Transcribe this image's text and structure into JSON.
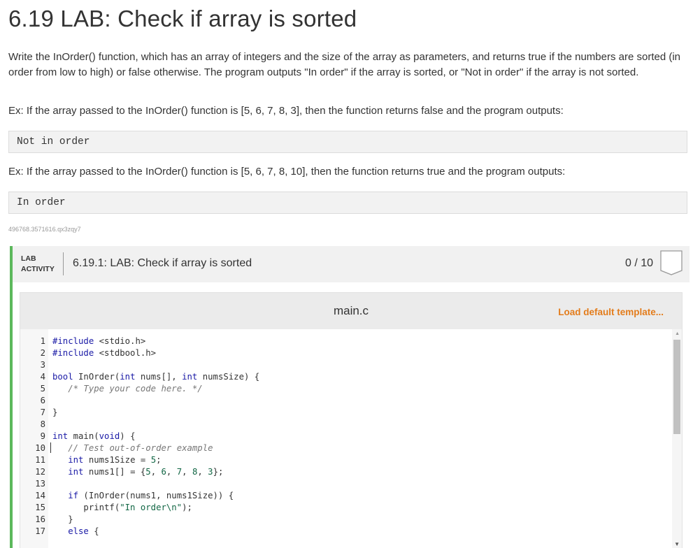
{
  "page": {
    "title": "6.19 LAB: Check if array is sorted",
    "description": "Write the InOrder() function, which has an array of integers and the size of the array as parameters, and returns true if the numbers are sorted (in order from low to high) or false otherwise. The program outputs \"In order\" if the array is sorted, or \"Not in order\" if the array is not sorted.",
    "example1": "Ex: If the array passed to the InOrder() function is [5, 6, 7, 8, 3], then the function returns false and the program outputs:",
    "output1": "Not in order",
    "example2": "Ex: If the array passed to the InOrder() function is [5, 6, 7, 8, 10], then the function returns true and the program outputs:",
    "output2": "In order",
    "hash": "496768.3571616.qx3zqy7"
  },
  "lab": {
    "tag_line1": "LAB",
    "tag_line2": "ACTIVITY",
    "title": "6.19.1: LAB: Check if array is sorted",
    "score": "0 / 10",
    "accent_color": "#5cb85c"
  },
  "editor": {
    "filename": "main.c",
    "load_template_label": "Load default template...",
    "load_template_color": "#e37c1b",
    "line_numbers": [
      "1",
      "2",
      "3",
      "4",
      "5",
      "6",
      "7",
      "8",
      "9",
      "10",
      "11",
      "12",
      "13",
      "14",
      "15",
      "16",
      "17"
    ]
  }
}
